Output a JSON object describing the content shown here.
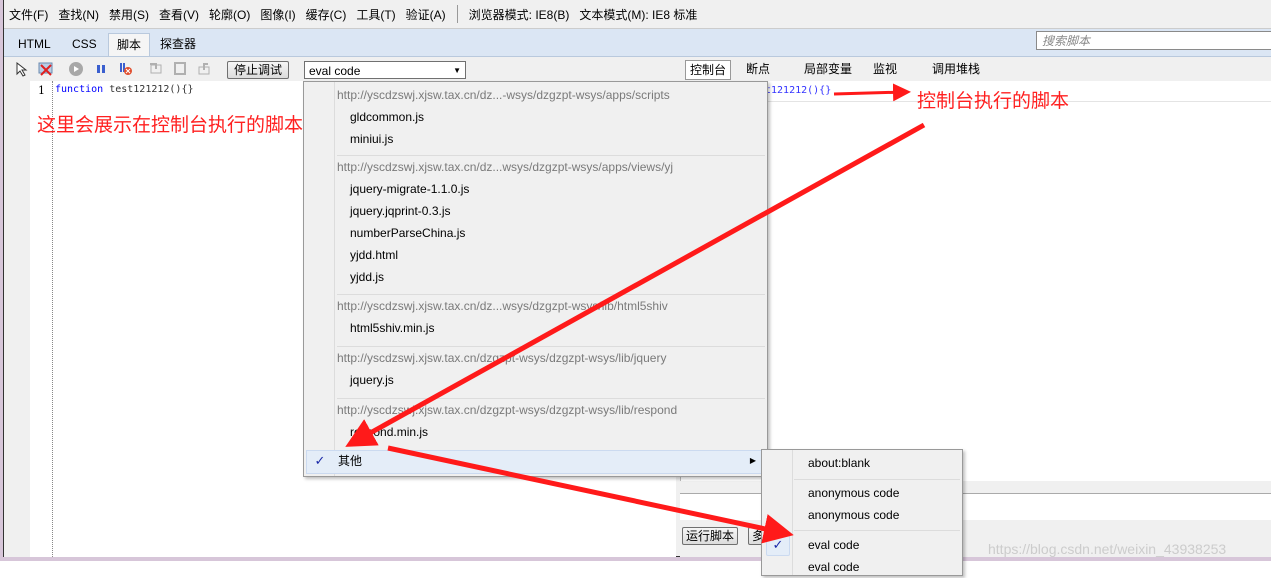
{
  "menubar": {
    "items": [
      "文件(F)",
      "查找(N)",
      "禁用(S)",
      "查看(V)",
      "轮廓(O)",
      "图像(I)",
      "缓存(C)",
      "工具(T)",
      "验证(A)"
    ],
    "browser_mode": "浏览器模式: IE8(B)",
    "document_mode": "文本模式(M): IE8 标准"
  },
  "tabs": [
    {
      "label": "HTML",
      "active": false
    },
    {
      "label": "CSS",
      "active": false
    },
    {
      "label": "脚本",
      "active": true
    },
    {
      "label": "探查器",
      "active": false
    }
  ],
  "search": {
    "placeholder": "搜索脚本"
  },
  "toolbar": {
    "icons": [
      "select-element-icon",
      "clear-browser-cache-icon",
      "start-debugging-icon",
      "pause-icon",
      "break-on-error-icon",
      "step-into-icon",
      "step-over-icon",
      "step-out-icon"
    ],
    "stop_debug_label": "停止调试",
    "script_select_value": "eval code"
  },
  "editor": {
    "line_number": "1",
    "code_keyword": "function",
    "code_rest": " test121212(){}"
  },
  "right_tabs": [
    {
      "label": "控制台",
      "active": true
    },
    {
      "label": "断点",
      "active": false
    },
    {
      "label": "局部变量",
      "active": false
    },
    {
      "label": "监视",
      "active": false
    },
    {
      "label": "调用堆栈",
      "active": false
    }
  ],
  "console": {
    "output": "t121212(){}",
    "run_button": "运行脚本",
    "multiline_button": "多"
  },
  "dropdown": {
    "groups": [
      {
        "url": "http://yscdzswj.xjsw.tax.cn/dz...-wsys/dzgzpt-wsys/apps/scripts",
        "items": [
          "gldcommon.js",
          "miniui.js"
        ]
      },
      {
        "url": "http://yscdzswj.xjsw.tax.cn/dz...wsys/dzgzpt-wsys/apps/views/yj",
        "items": [
          "jquery-migrate-1.1.0.js",
          "jquery.jqprint-0.3.js",
          "numberParseChina.js",
          "yjdd.html",
          "yjdd.js"
        ]
      },
      {
        "url": "http://yscdzswj.xjsw.tax.cn/dz...wsys/dzgzpt-wsys/lib/html5shiv",
        "items": [
          "html5shiv.min.js"
        ]
      },
      {
        "url": "http://yscdzswj.xjsw.tax.cn/dzgzpt-wsys/dzgzpt-wsys/lib/jquery",
        "items": [
          "jquery.js"
        ]
      },
      {
        "url": "http://yscdzswj.xjsw.tax.cn/dzgzpt-wsys/dzgzpt-wsys/lib/respond",
        "items": [
          "respond.min.js"
        ]
      }
    ],
    "other_label": "其他",
    "other_checked": true
  },
  "submenu": {
    "items": [
      "about:blank",
      "anonymous code",
      "anonymous code",
      "eval code",
      "eval code"
    ],
    "checked_index": 3
  },
  "annotations": {
    "left": "这里会展示在控制台执行的脚本",
    "right": "控制台执行的脚本"
  },
  "watermark": "https://blog.csdn.net/weixin_43938253",
  "colors": {
    "annotation": "#ff2020",
    "keyword": "#0000ff",
    "check": "#1c2aa8"
  }
}
